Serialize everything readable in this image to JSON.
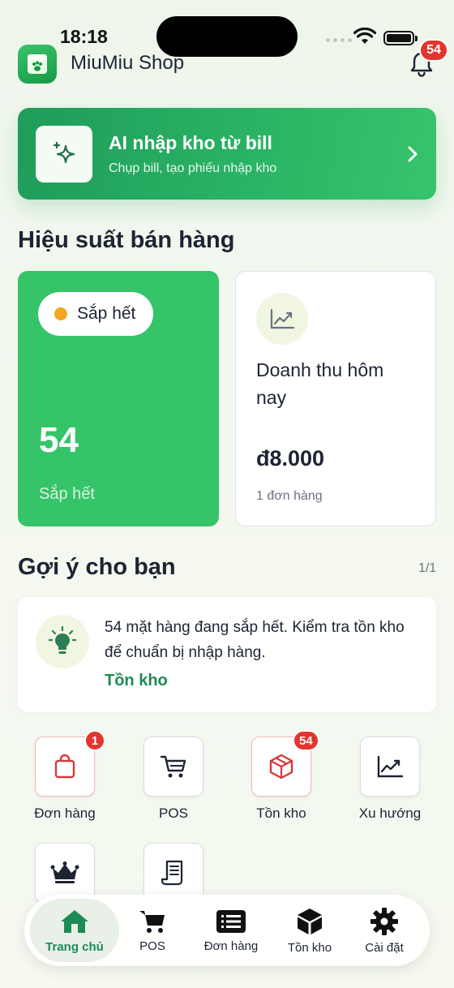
{
  "status_bar": {
    "time": "18:18"
  },
  "header": {
    "shop_name": "MiuMiu Shop",
    "notification_count": "54"
  },
  "ai_banner": {
    "title": "AI nhập kho từ bill",
    "subtitle": "Chụp bill, tạo phiếu nhập kho"
  },
  "performance": {
    "title": "Hiệu suất bán hàng",
    "low_stock": {
      "pill_label": "Sắp hết",
      "value": "54",
      "caption": "Sắp hết"
    },
    "revenue": {
      "title": "Doanh thu hôm nay",
      "value": "đ8.000",
      "orders": "1 đơn hàng"
    }
  },
  "suggestions": {
    "title": "Gợi ý cho bạn",
    "page": "1/1",
    "text": "54 mặt hàng đang sắp hết. Kiểm tra tồn kho để chuẩn bị nhập hàng.",
    "link": "Tồn kho"
  },
  "quick_actions": [
    {
      "label": "Đơn hàng",
      "badge": "1",
      "icon": "shopping-bag-icon"
    },
    {
      "label": "POS",
      "icon": "cart-icon"
    },
    {
      "label": "Tồn kho",
      "badge": "54",
      "icon": "box-icon"
    },
    {
      "label": "Xu hướng",
      "icon": "trend-chart-icon"
    },
    {
      "label": "",
      "icon": "crown-icon"
    },
    {
      "label": "",
      "icon": "document-icon"
    }
  ],
  "bottom_nav": [
    {
      "label": "Trang chủ",
      "icon": "home-icon",
      "active": true
    },
    {
      "label": "POS",
      "icon": "cart-icon"
    },
    {
      "label": "Đơn hàng",
      "icon": "list-icon"
    },
    {
      "label": "Tồn kho",
      "icon": "box-icon"
    },
    {
      "label": "Cài đặt",
      "icon": "gear-icon"
    }
  ],
  "colors": {
    "brand_green": "#36c468",
    "link_green": "#1e8a55",
    "badge_red": "#e3342f",
    "warning_orange": "#f5a623"
  }
}
